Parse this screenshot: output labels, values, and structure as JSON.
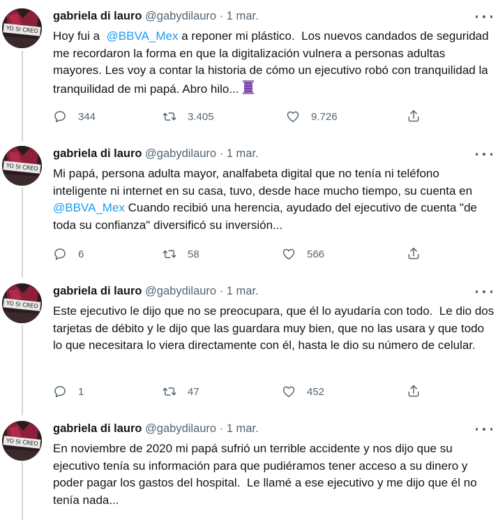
{
  "tweets": [
    {
      "name": "gabriela di lauro",
      "handle": "@gabydilauro",
      "separator": "·",
      "date": "1 mar.",
      "text_before": "Hoy fui a  ",
      "mention": "@BBVA_Mex",
      "text_after": " a reponer mi plástico.  Los nuevos candados de seguridad me recordaron la forma en que la digitalización vulnera a personas adultas mayores. Les voy a contar la historia de cómo un ejecutivo robó con tranquilidad la tranquilidad de mi papá. Abro hilo... ",
      "emoji": "thread-spool-icon",
      "replies": "344",
      "retweets": "3.405",
      "likes": "9.726"
    },
    {
      "name": "gabriela di lauro",
      "handle": "@gabydilauro",
      "separator": "·",
      "date": "1 mar.",
      "text_before": "Mi papá, persona adulta mayor, analfabeta digital que no tenía ni teléfono inteligente ni internet en su casa, tuvo, desde hace mucho tiempo, su cuenta en ",
      "mention": "@BBVA_Mex",
      "text_after": " Cuando recibió una herencia, ayudado del ejecutivo de cuenta \"de toda su confianza\" diversificó su inversión...",
      "replies": "6",
      "retweets": "58",
      "likes": "566"
    },
    {
      "name": "gabriela di lauro",
      "handle": "@gabydilauro",
      "separator": "·",
      "date": "1 mar.",
      "text_before": "Este ejecutivo le dijo que no se preocupara, que él lo ayudaría con todo.  Le dio dos tarjetas de débito y le dijo que las guardara muy bien, que no las usara y que todo lo que necesitara lo viera directamente con él, hasta le dio su número de celular.",
      "replies": "1",
      "retweets": "47",
      "likes": "452"
    },
    {
      "name": "gabriela di lauro",
      "handle": "@gabydilauro",
      "separator": "·",
      "date": "1 mar.",
      "text_before": "En noviembre de 2020 mi papá sufrió un terrible accidente y nos dijo que su ejecutivo tenía su información para que pudiéramos tener acceso a su dinero y poder pagar los gastos del hospital.  Le llamé a ese ejecutivo y me dijo que él no tenía nada..."
    }
  ],
  "colors": {
    "text": "#0f1419",
    "secondary": "#536471",
    "mention": "#1d9bf0",
    "thread_line": "#cfd9de"
  }
}
